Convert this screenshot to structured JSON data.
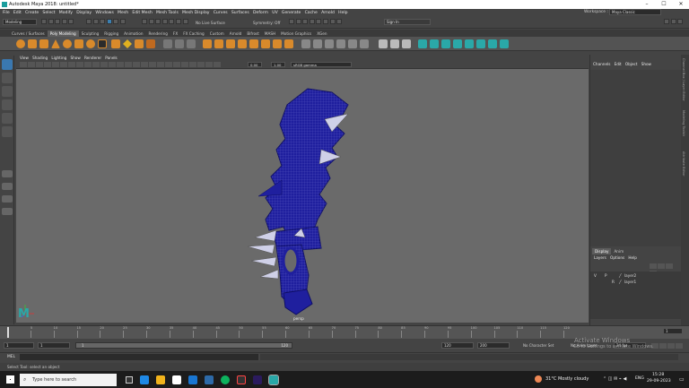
{
  "window": {
    "title": "Autodesk Maya 2018: untitled*",
    "controls": [
      "–",
      "☐",
      "✕"
    ]
  },
  "menubar": [
    "File",
    "Edit",
    "Create",
    "Select",
    "Modify",
    "Display",
    "Windows",
    "Mesh",
    "Edit Mesh",
    "Mesh Tools",
    "Mesh Display",
    "Curves",
    "Surfaces",
    "Deform",
    "UV",
    "Generate",
    "Cache",
    "Arnold",
    "Help"
  ],
  "workspace": {
    "label": "Workspace :",
    "value": "Maya Classic"
  },
  "status": {
    "mode": "Modeling",
    "live": "No Live Surface",
    "symmetry": "Symmetry: Off",
    "signin": "Sign In"
  },
  "shelf_tabs": [
    "Curves / Surfaces",
    "Poly Modeling",
    "Sculpting",
    "Rigging",
    "Animation",
    "Rendering",
    "FX",
    "FX Caching",
    "Custom",
    "Arnold",
    "Bifrost",
    "MASH",
    "Motion Graphics",
    "XGen"
  ],
  "active_shelf_tab": "Poly Modeling",
  "panel_menu": [
    "View",
    "Shading",
    "Lighting",
    "Show",
    "Renderer",
    "Panels"
  ],
  "panel_tool": {
    "value1": "0.00",
    "value2": "1.00",
    "colorspace": "sRGB gamma"
  },
  "viewport": {
    "camera_label": "persp",
    "logo": "M",
    "axis": [
      "x",
      "y",
      "z"
    ]
  },
  "channel_box": {
    "menu": [
      "Channels",
      "Edit",
      "Object",
      "Show"
    ]
  },
  "vertical_tabs": [
    "Channel Box / Layer Editor",
    "Modeling Toolkit",
    "Attribute Editor"
  ],
  "layer_editor": {
    "tabs": [
      "Display",
      "Anim"
    ],
    "menu": [
      "Layers",
      "Options",
      "Help"
    ],
    "layers": [
      {
        "v": "V",
        "p": "P",
        "name": "layer2"
      },
      {
        "v": "",
        "p": "R",
        "name": "layer1"
      }
    ]
  },
  "timeline": {
    "ticks": [
      "1",
      "5",
      "10",
      "15",
      "20",
      "25",
      "30",
      "35",
      "40",
      "45",
      "50",
      "55",
      "60",
      "65",
      "70",
      "75",
      "80",
      "85",
      "90",
      "95",
      "100",
      "105",
      "110",
      "115",
      "120"
    ],
    "current": "1"
  },
  "range": {
    "start": "1",
    "start2": "1",
    "field": "1",
    "end_inner": "120",
    "end": "120",
    "end_outer": "200",
    "character": "No Character Set",
    "anim_layer": "No Anim Layer",
    "fps": "24 fps"
  },
  "mel": {
    "label": "MEL"
  },
  "help_line": "Select Tool: select an object",
  "watermark": {
    "line1": "Activate Windows",
    "line2": "Go to Settings to activate Windows."
  },
  "taskbar": {
    "search": "Type here to search",
    "weather": "31°C  Mostly cloudy",
    "lang": "ENG",
    "time": "15:28",
    "date": "29-09-2023"
  },
  "colors": {
    "mesh": "#1f1f9e",
    "wire": "#7b7bd8",
    "viewport": "#6a6a6a",
    "accent_teal": "#2aa8a8"
  }
}
